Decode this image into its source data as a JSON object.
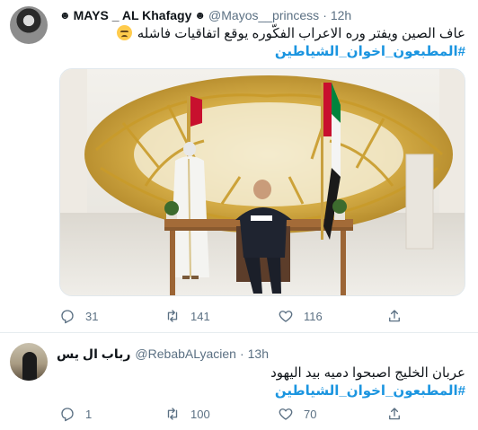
{
  "tweets": [
    {
      "display_name": "MAYS _ AL Khafagy",
      "handle": "@Mayos__princess",
      "separator": "·",
      "time": "12h",
      "text_line1": "عاف الصين ويفتر وره الاعراب الفكّوره يوقع اتفاقيات فاشله",
      "hashtag": "#المطبعون_اخوان_الشياطين",
      "emoji": "confounded-face",
      "replies": "31",
      "retweets": "141",
      "likes": "116"
    },
    {
      "display_name": "رباب ال يس",
      "handle": "@RebabALyacien",
      "separator": "·",
      "time": "13h",
      "text_line1": "عربان الخليج اصبحوا دميه بيد اليهود",
      "hashtag": "#المطبعون_اخوان_الشياطين",
      "replies": "1",
      "retweets": "100",
      "likes": "70"
    }
  ],
  "badge_glyph": "☻",
  "colors": {
    "hashtag": "#1b95e0",
    "muted": "#5b7083",
    "border": "#e6ecf0"
  }
}
